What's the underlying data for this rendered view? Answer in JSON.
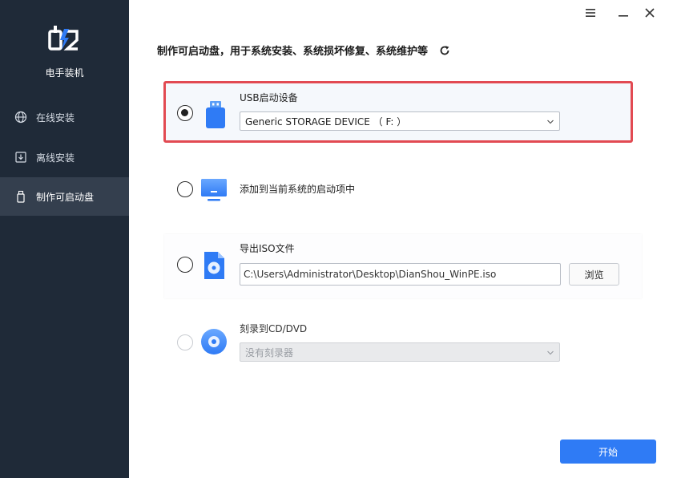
{
  "sidebar": {
    "app_name": "电手装机",
    "items": [
      {
        "label": "在线安装",
        "icon": "globe-icon",
        "active": false
      },
      {
        "label": "离线安装",
        "icon": "download-box-icon",
        "active": false
      },
      {
        "label": "制作可启动盘",
        "icon": "usb-drive-icon",
        "active": true
      }
    ]
  },
  "window_controls": [
    "menu-icon",
    "minimize-icon",
    "close-icon"
  ],
  "main": {
    "heading": "制作可启动盘，用于系统安装、系统损坏修复、系统维护等",
    "options": {
      "usb": {
        "label": "USB启动设备",
        "selected": true,
        "device_value": "Generic STORAGE DEVICE （ F: ）"
      },
      "system": {
        "label": "添加到当前系统的启动项中",
        "selected": false
      },
      "iso": {
        "label": "导出ISO文件",
        "selected": false,
        "path_value": "C:\\Users\\Administrator\\Desktop\\DianShou_WinPE.iso",
        "browse_label": "浏览"
      },
      "cd": {
        "label": "刻录到CD/DVD",
        "selected": false,
        "disabled": true,
        "burner_value": "没有刻录器"
      }
    },
    "start_label": "开始"
  },
  "colors": {
    "sidebar_bg": "#1f2a38",
    "sidebar_active": "#343f4e",
    "accent": "#2f7bf5",
    "highlight_border": "#e24a52"
  }
}
